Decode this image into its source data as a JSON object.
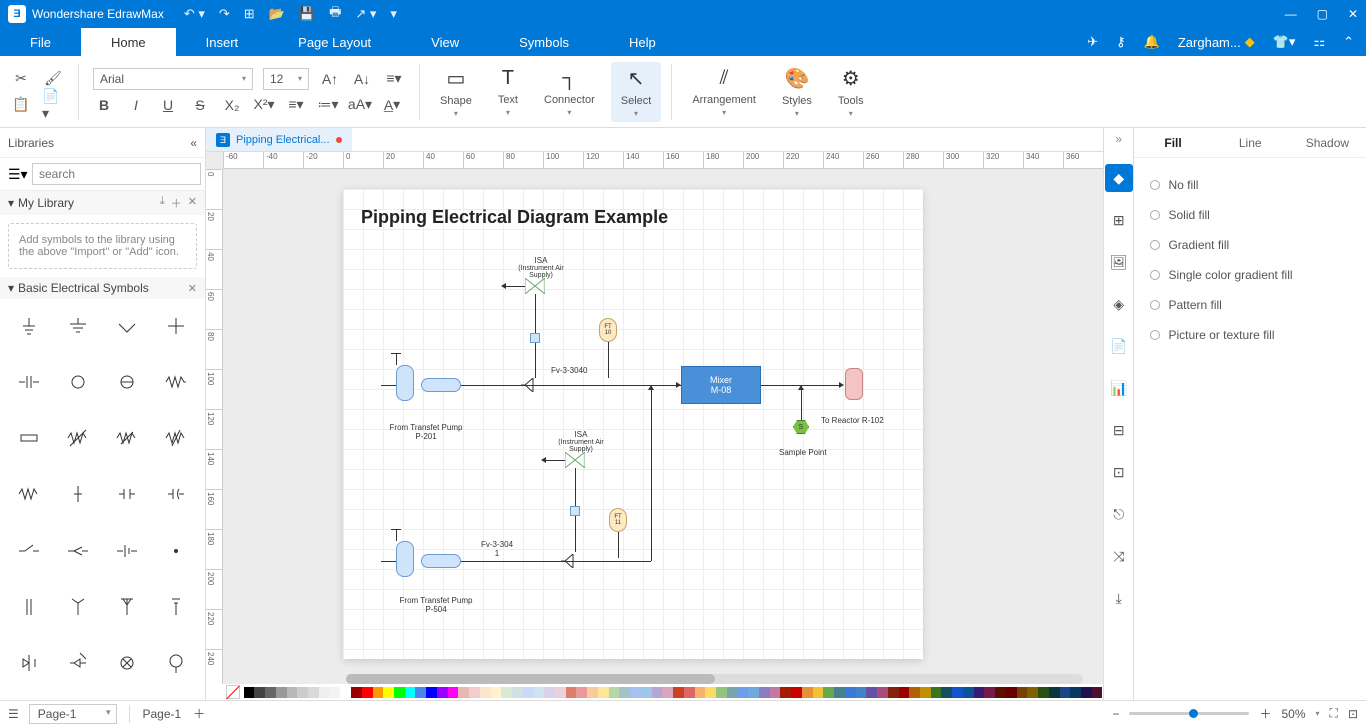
{
  "app": {
    "name": "Wondershare EdrawMax"
  },
  "menu": {
    "items": [
      "File",
      "Home",
      "Insert",
      "Page Layout",
      "View",
      "Symbols",
      "Help"
    ],
    "active": "Home",
    "user": "Zargham..."
  },
  "ribbon": {
    "font_name": "Arial",
    "font_size": "12",
    "tools": {
      "shape": "Shape",
      "text": "Text",
      "connector": "Connector",
      "select": "Select",
      "arrangement": "Arrangement",
      "styles": "Styles",
      "tools": "Tools"
    }
  },
  "left": {
    "title": "Libraries",
    "search_placeholder": "search",
    "my_library": "My Library",
    "placeholder_text": "Add symbols to the library using the above \"Import\" or \"Add\" icon.",
    "section2": "Basic Electrical Symbols"
  },
  "tab": {
    "name": "Pipping Electrical..."
  },
  "ruler_top": [
    "-60",
    "-40",
    "-20",
    "0",
    "20",
    "40",
    "60",
    "80",
    "100",
    "120",
    "140",
    "160",
    "180",
    "200",
    "220",
    "240",
    "260",
    "280",
    "300",
    "320",
    "340",
    "360"
  ],
  "ruler_left": [
    "0",
    "20",
    "40",
    "60",
    "80",
    "100",
    "120",
    "140",
    "160",
    "180",
    "200",
    "220",
    "240"
  ],
  "diagram": {
    "title": "Pipping Electrical Diagram Example",
    "isa1": "ISA",
    "isa1_sub": "(Instrument Air Supply)",
    "isa2": "ISA",
    "isa2_sub": "(Instrument Air Supply)",
    "fv1": "Fv-3-3040",
    "fv2_a": "Fv-3-304",
    "fv2_b": "1",
    "pump1_a": "From Transfet Pump",
    "pump1_b": "P-201",
    "pump2_a": "From Transfet Pump",
    "pump2_b": "P-504",
    "mixer_a": "Mixer",
    "mixer_b": "M-08",
    "reactor": "To Reactor R-102",
    "sample": "Sample Point",
    "sample_s": "S",
    "ft10_a": "FT",
    "ft10_b": "10",
    "ft11_a": "FT",
    "ft11_b": "11"
  },
  "right": {
    "tabs": [
      "Fill",
      "Line",
      "Shadow"
    ],
    "active": "Fill",
    "options": [
      "No fill",
      "Solid fill",
      "Gradient fill",
      "Single color gradient fill",
      "Pattern fill",
      "Picture or texture fill"
    ]
  },
  "status": {
    "page_sel": "Page-1",
    "page_tab": "Page-1",
    "zoom": "50%"
  },
  "colors": [
    "#000000",
    "#434343",
    "#666666",
    "#999999",
    "#b7b7b7",
    "#cccccc",
    "#d9d9d9",
    "#efefef",
    "#f3f3f3",
    "#ffffff",
    "#980000",
    "#ff0000",
    "#ff9900",
    "#ffff00",
    "#00ff00",
    "#00ffff",
    "#4a86e8",
    "#0000ff",
    "#9900ff",
    "#ff00ff",
    "#e6b8af",
    "#f4cccc",
    "#fce5cd",
    "#fff2cc",
    "#d9ead3",
    "#d0e0e3",
    "#c9daf8",
    "#cfe2f3",
    "#d9d2e9",
    "#ead1dc",
    "#dd7e6b",
    "#ea9999",
    "#f9cb9c",
    "#ffe599",
    "#b6d7a8",
    "#a2c4c9",
    "#a4c2f4",
    "#9fc5e8",
    "#b4a7d6",
    "#d5a6bd",
    "#cc4125",
    "#e06666",
    "#f6b26b",
    "#ffd966",
    "#93c47d",
    "#76a5af",
    "#6d9eeb",
    "#6fa8dc",
    "#8e7cc3",
    "#c27ba0",
    "#a61c00",
    "#cc0000",
    "#e69138",
    "#f1c232",
    "#6aa84f",
    "#45818e",
    "#3c78d8",
    "#3d85c6",
    "#674ea7",
    "#a64d79",
    "#85200c",
    "#990000",
    "#b45f06",
    "#bf9000",
    "#38761d",
    "#134f5c",
    "#1155cc",
    "#0b5394",
    "#351c75",
    "#741b47",
    "#5b0f00",
    "#660000",
    "#783f04",
    "#7f6000",
    "#274e13",
    "#0c343d",
    "#1c4587",
    "#073763",
    "#20124d",
    "#4c1130"
  ]
}
